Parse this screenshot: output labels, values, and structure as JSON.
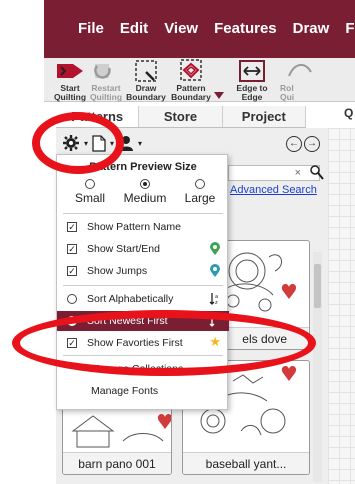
{
  "menu": {
    "items": [
      "File",
      "Edit",
      "View",
      "Features",
      "Draw",
      "F"
    ]
  },
  "toolbar": {
    "start": "Start Quilting",
    "restart": "Restart Quilting",
    "draw_boundary": "Draw Boundary",
    "pattern_boundary": "Pattern Boundary",
    "edge_to_edge": "Edge to Edge",
    "rol": "Rol Qui"
  },
  "tabs": [
    "Patterns",
    "Store",
    "Project"
  ],
  "q_tab": "Q",
  "search": {
    "placeholder": "",
    "clear": "×"
  },
  "advanced_search": "Advanced Search",
  "dropdown": {
    "heading": "Pattern Preview Size",
    "sizes": [
      "Small",
      "Medium",
      "Large"
    ],
    "selected_size": "Medium",
    "options": [
      {
        "label": "Show Pattern Name",
        "checked": true
      },
      {
        "label": "Show Start/End",
        "checked": true
      },
      {
        "label": "Show Jumps",
        "checked": true
      },
      {
        "label": "Sort Alphabetically",
        "checked": false
      },
      {
        "label": "Sort Newest First",
        "checked": true
      },
      {
        "label": "Show Favorties First",
        "checked": true
      }
    ],
    "manage_collections": "Manage Collections",
    "manage_fonts": "Manage Fonts"
  },
  "thumbs": [
    {
      "label": ""
    },
    {
      "label": "els dove"
    },
    {
      "label": "barn pano 001"
    },
    {
      "label": "baseball yant..."
    }
  ],
  "colors": {
    "brand": "#7a1f33",
    "annotation": "#e8121b",
    "link": "#1a3fd0"
  }
}
